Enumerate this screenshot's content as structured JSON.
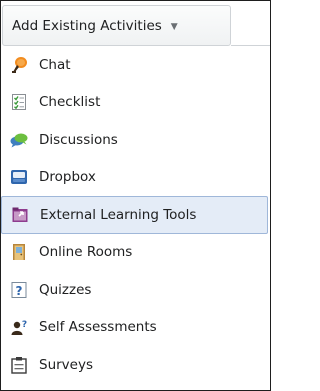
{
  "dropdown": {
    "label": "Add Existing Activities",
    "caret": "▼"
  },
  "menu": {
    "items": [
      {
        "label": "Chat",
        "icon": "chat-icon"
      },
      {
        "label": "Checklist",
        "icon": "checklist-icon"
      },
      {
        "label": "Discussions",
        "icon": "discussions-icon"
      },
      {
        "label": "Dropbox",
        "icon": "dropbox-icon"
      },
      {
        "label": "External Learning Tools",
        "icon": "external-learning-tools-icon",
        "highlighted": true
      },
      {
        "label": "Online Rooms",
        "icon": "online-rooms-icon"
      },
      {
        "label": "Quizzes",
        "icon": "quizzes-icon"
      },
      {
        "label": "Self Assessments",
        "icon": "self-assessments-icon"
      },
      {
        "label": "Surveys",
        "icon": "surveys-icon"
      }
    ]
  },
  "colors": {
    "highlight_bg": "#e4ecf7",
    "highlight_border": "#9fb7d9",
    "text": "#202122"
  }
}
